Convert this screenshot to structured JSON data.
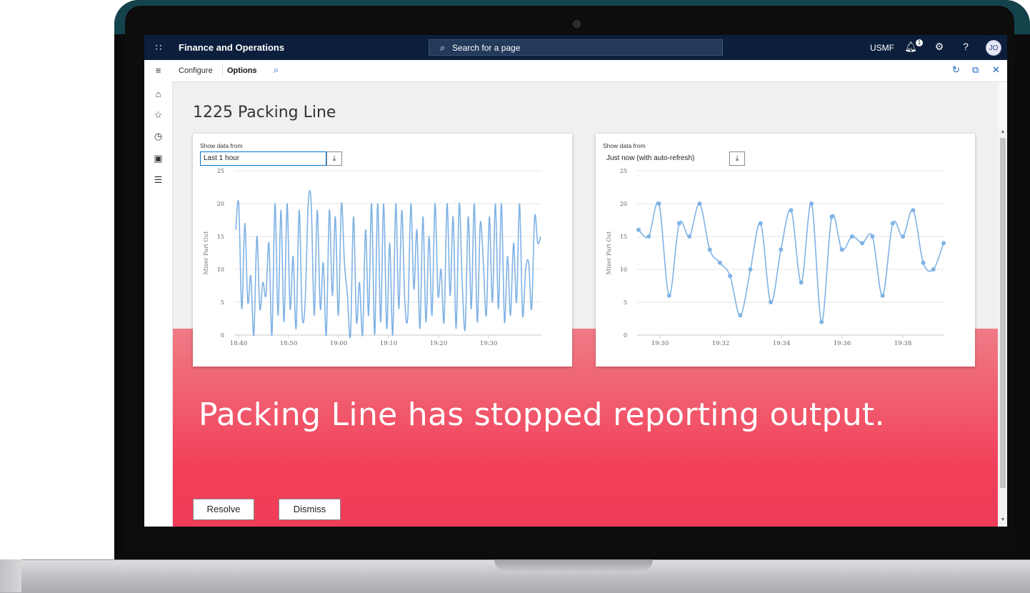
{
  "app": {
    "title": "Finance and Operations",
    "search_placeholder": "Search for a page",
    "company": "USMF",
    "notification_count": "1",
    "help_label": "?",
    "user_initials": "JO"
  },
  "actionbar": {
    "configure_label": "Configure",
    "options_label": "Options"
  },
  "nav": {
    "icons": [
      "menu-icon",
      "home-icon",
      "favorites-icon",
      "recent-icon",
      "workspaces-icon",
      "modules-icon"
    ]
  },
  "page": {
    "title": "1225 Packing Line"
  },
  "cards": [
    {
      "filter_label": "Show data from",
      "filter_value": "Last 1 hour"
    },
    {
      "filter_label": "Show data from",
      "filter_value": "Just now (with auto-refresh)"
    }
  ],
  "alert": {
    "message": "Packing Line has stopped reporting output.",
    "resolve_label": "Resolve",
    "dismiss_label": "Dismiss"
  },
  "colors": {
    "topbar": "#0b1e3b",
    "line": "#7fb2e5",
    "alert": "#f2405a"
  },
  "chart_data": [
    {
      "type": "line",
      "ylabel": "Mixer Part Out",
      "ylim": [
        0,
        25
      ],
      "yticks": [
        0,
        5,
        10,
        15,
        20,
        25
      ],
      "xticks": [
        "18:40",
        "18:50",
        "19:00",
        "19:10",
        "19:20",
        "19:30"
      ],
      "x_range_minutes": [
        0,
        60
      ],
      "values": [
        16,
        20,
        4,
        17,
        5,
        9,
        0,
        15,
        4,
        8,
        6,
        14,
        0,
        20,
        3,
        19,
        2,
        20,
        4,
        12,
        1,
        19,
        3,
        5,
        20,
        20,
        3,
        19,
        4,
        11,
        0,
        19,
        6,
        18,
        3,
        20,
        11,
        6,
        0,
        18,
        2,
        8,
        0,
        16,
        3,
        20,
        0,
        20,
        2,
        20,
        1,
        14,
        0,
        20,
        4,
        19,
        5,
        3,
        20,
        7,
        16,
        1,
        18,
        2,
        15,
        3,
        20,
        6,
        10,
        2,
        20,
        6,
        18,
        1,
        20,
        8,
        1,
        18,
        4,
        20,
        2,
        17,
        11,
        3,
        18,
        5,
        20,
        4,
        20,
        2,
        12,
        3,
        14,
        5,
        20,
        3,
        10,
        11,
        4,
        18,
        14,
        15
      ]
    },
    {
      "type": "line",
      "ylabel": "Mixer Part Out",
      "ylim": [
        0,
        25
      ],
      "yticks": [
        0,
        5,
        10,
        15,
        20,
        25
      ],
      "xticks": [
        "19:30",
        "19:32",
        "19:34",
        "19:36",
        "19:38"
      ],
      "markers": true,
      "values": [
        16,
        15,
        20,
        6,
        17,
        15,
        20,
        13,
        11,
        9,
        3,
        10,
        17,
        5,
        13,
        19,
        8,
        20,
        2,
        18,
        13,
        15,
        14,
        15,
        6,
        17,
        15,
        19,
        11,
        10,
        14
      ]
    }
  ]
}
